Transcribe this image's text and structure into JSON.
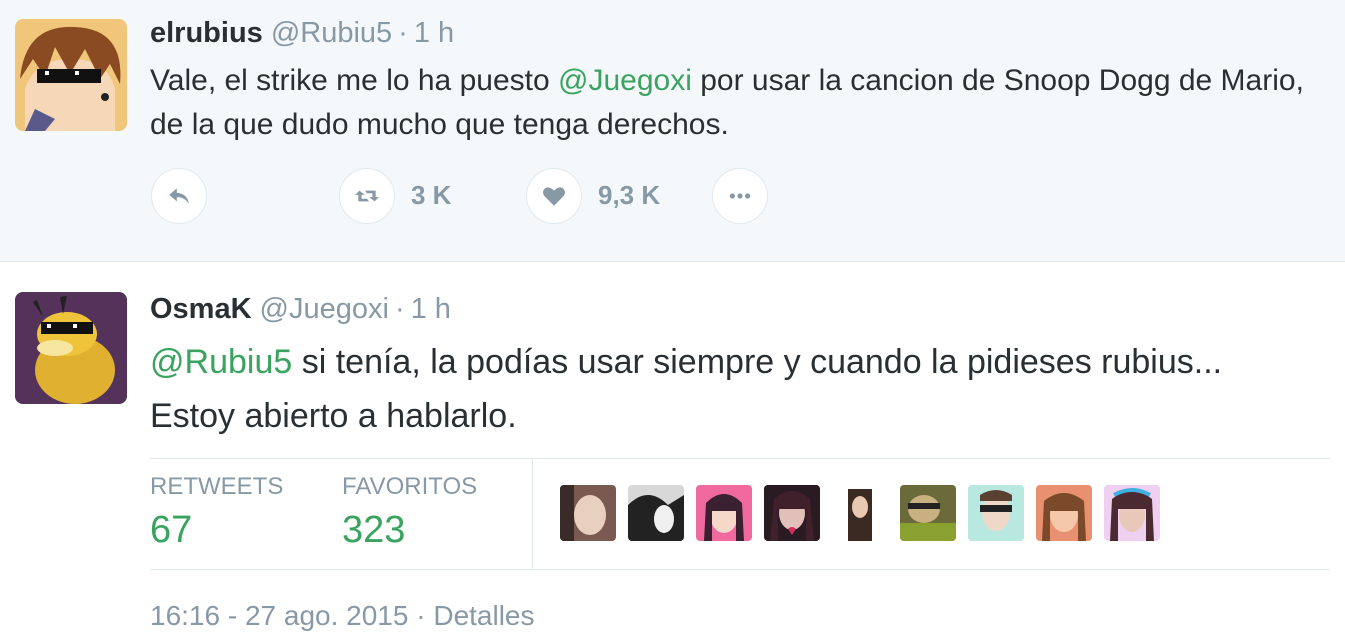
{
  "parent_tweet": {
    "name": "elrubius",
    "handle": "@Rubiu5",
    "separator": "·",
    "time": "1 h",
    "text_before": "Vale, el strike me lo ha puesto ",
    "mention": "@Juegoxi",
    "text_after": " por usar la cancion de Snoop Dogg de Mario, de la que dudo mucho que tenga derechos.",
    "actions": {
      "reply_icon": "reply-icon",
      "retweet_icon": "retweet-icon",
      "retweet_count": "3 K",
      "like_icon": "heart-icon",
      "like_count": "9,3 K",
      "more_icon": "more-icon"
    }
  },
  "main_tweet": {
    "name": "OsmaK",
    "handle": "@Juegoxi",
    "separator": "·",
    "time": "1 h",
    "mention": "@Rubiu5",
    "text_after": " si tenía, la podías usar siempre y cuando la pidieses rubius... Estoy abierto a hablarlo.",
    "stats": {
      "retweets_label": "RETWEETS",
      "retweets_value": "67",
      "favorites_label": "FAVORITOS",
      "favorites_value": "323"
    },
    "favoriter_count_shown": 9,
    "timestamp": "16:16 - 27 ago. 2015",
    "timestamp_separator": "·",
    "details_label": "Detalles"
  },
  "colors": {
    "mention": "#3aa35f",
    "muted": "#8899a6",
    "parent_bg": "#f5f8fa",
    "stat_value": "#3aa35f"
  }
}
